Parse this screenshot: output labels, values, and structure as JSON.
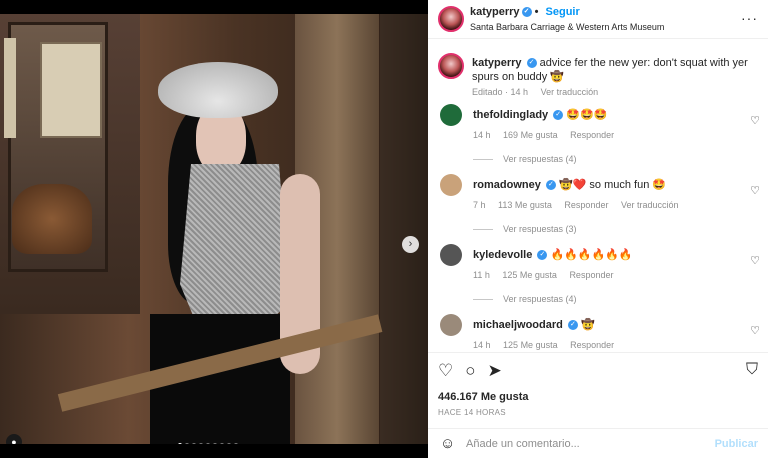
{
  "post": {
    "carousel_dots": 9,
    "active_dot": 0
  },
  "header": {
    "username": "katyperry",
    "follow": "Seguir",
    "location": "Santa Barbara Carriage & Western Arts Museum",
    "more": "···"
  },
  "caption": {
    "username": "katyperry",
    "text": "advice fer the new yer: don't squat with yer spurs on buddy 🤠",
    "edited": "Editado · 14 h",
    "translation": "Ver traducción"
  },
  "comments": [
    {
      "username": "thefoldinglady",
      "text": "🤩🤩🤩",
      "time": "14 h",
      "likes": "169 Me gusta",
      "reply": "Responder",
      "translation": "",
      "replies": "Ver respuestas (4)",
      "avatar_color": "#1f6b3a"
    },
    {
      "username": "romadowney",
      "text": "🤠❤️ so much fun 🤩",
      "time": "7 h",
      "likes": "113 Me gusta",
      "reply": "Responder",
      "translation": "Ver traducción",
      "replies": "Ver respuestas (3)",
      "avatar_color": "#c9a27a"
    },
    {
      "username": "kyledevolle",
      "text": "🔥🔥🔥🔥🔥🔥",
      "time": "11 h",
      "likes": "125 Me gusta",
      "reply": "Responder",
      "translation": "",
      "replies": "Ver respuestas (4)",
      "avatar_color": "#555555"
    },
    {
      "username": "michaeljwoodard",
      "text": "🤠",
      "time": "14 h",
      "likes": "125 Me gusta",
      "reply": "Responder",
      "translation": "",
      "replies": "",
      "avatar_color": "#9a8a7a"
    }
  ],
  "actions": {
    "likes": "446.167 Me gusta",
    "ago": "HACE 14 HORAS"
  },
  "add_comment": {
    "placeholder": "Añade un comentario...",
    "publish": "Publicar"
  },
  "colors": {
    "accent": "#0095f6",
    "verified": "#3897f0",
    "muted": "#8e8e8e"
  }
}
